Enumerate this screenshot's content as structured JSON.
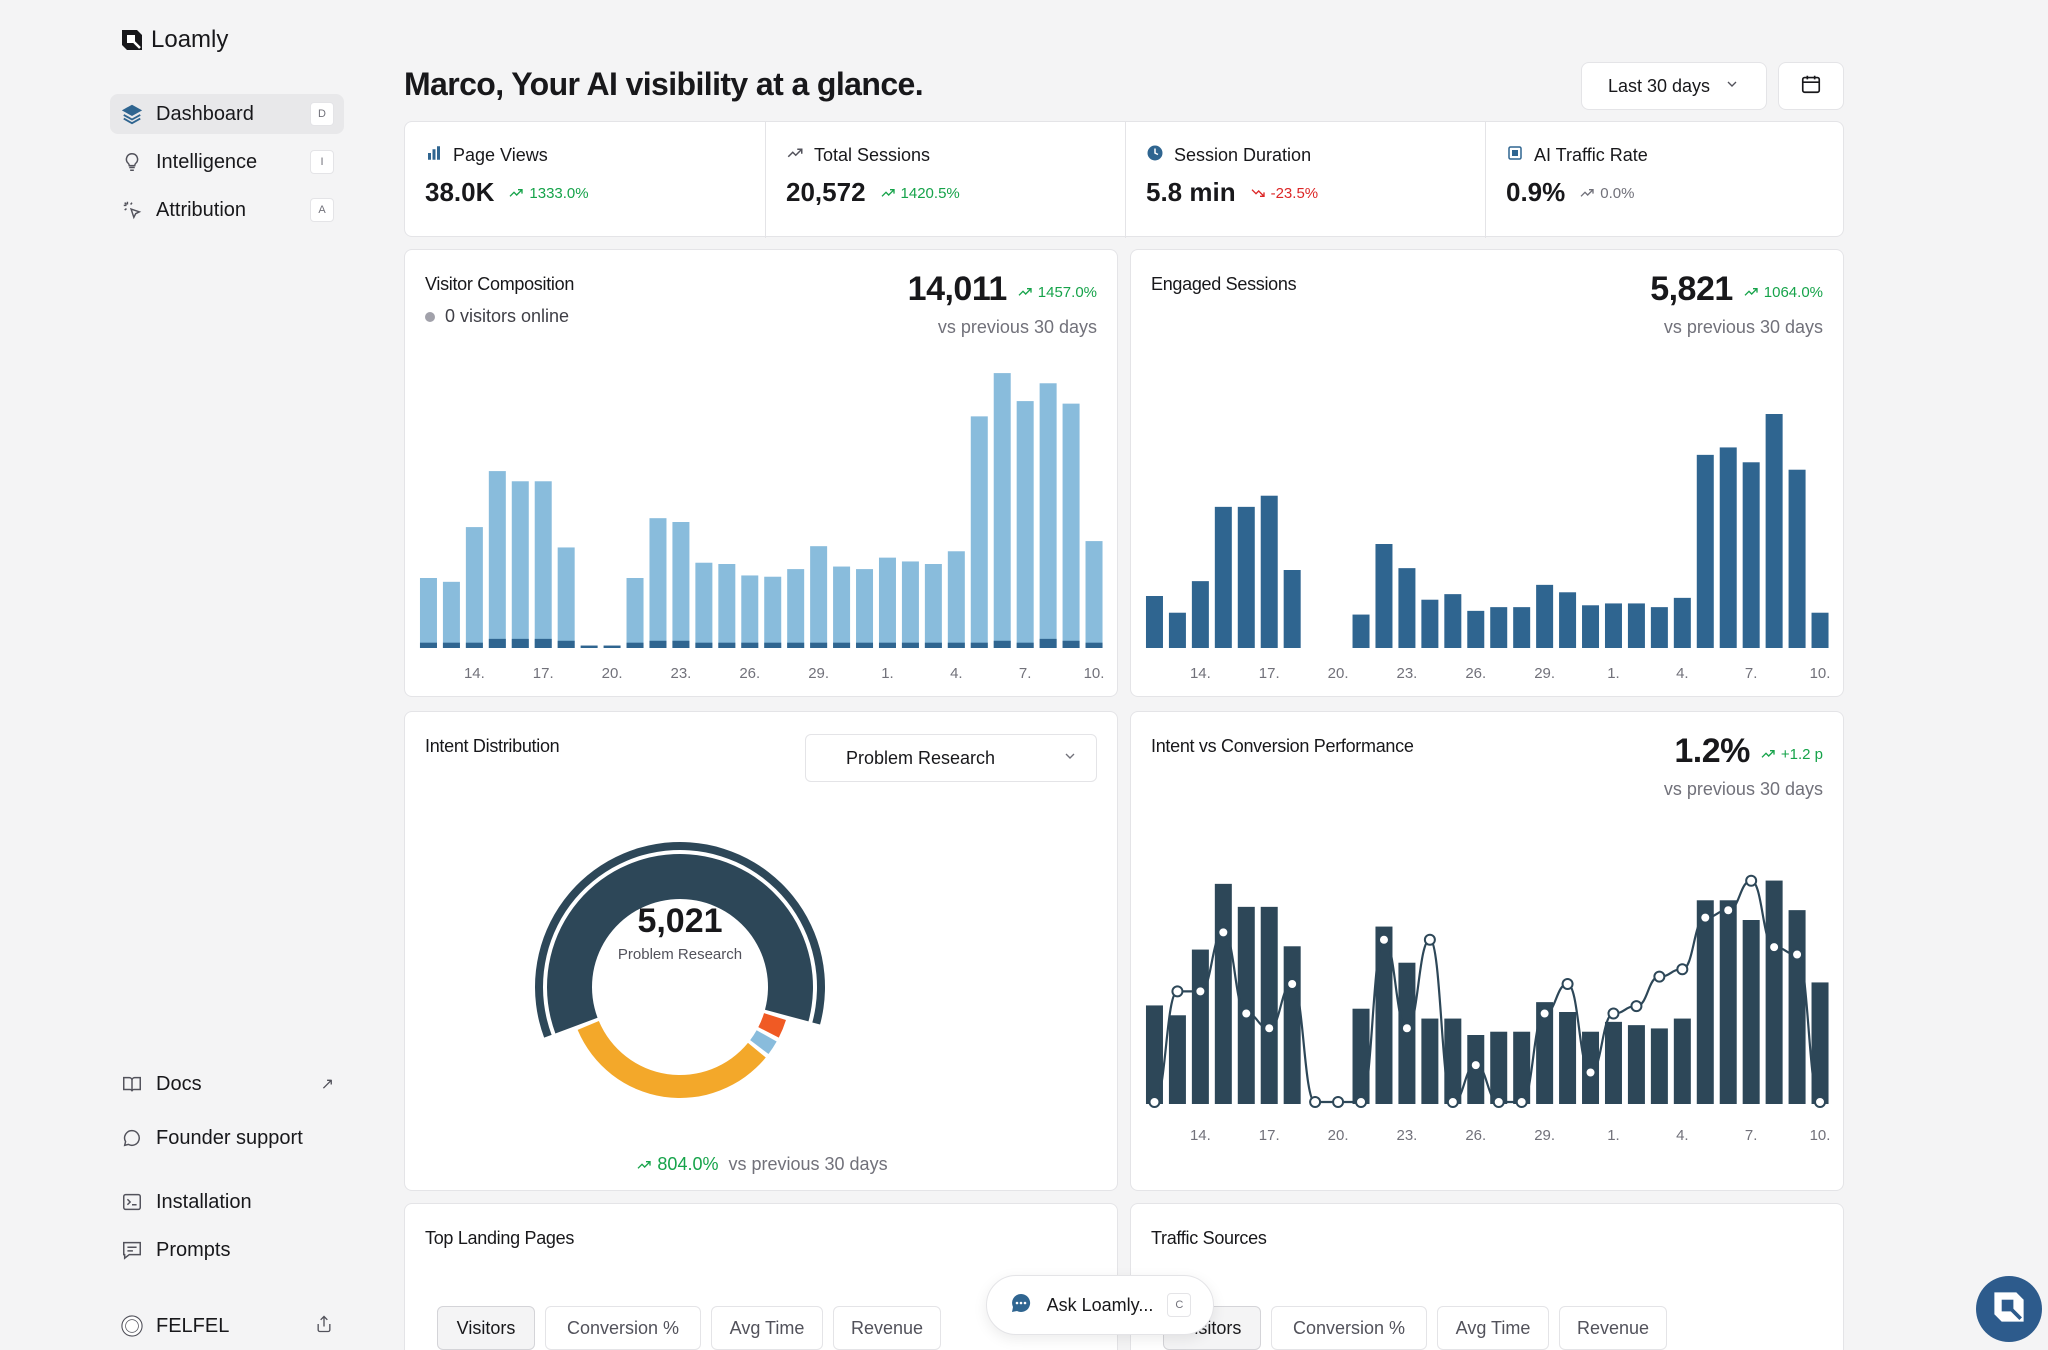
{
  "brand": {
    "name": "Loamly"
  },
  "sidebar": {
    "items": [
      {
        "label": "Dashboard",
        "key": "D"
      },
      {
        "label": "Intelligence",
        "key": "I"
      },
      {
        "label": "Attribution",
        "key": "A"
      }
    ],
    "bottom": [
      {
        "label": "Docs",
        "ext": "↗"
      },
      {
        "label": "Founder support"
      },
      {
        "label": "Installation"
      },
      {
        "label": "Prompts"
      }
    ],
    "workspace": "FELFEL"
  },
  "header": {
    "title": "Marco, Your AI visibility at a glance.",
    "range_label": "Last 30 days"
  },
  "stats": [
    {
      "label": "Page Views",
      "value": "38.0K",
      "change": "1333.0%",
      "dir": "up",
      "icon": "bar-chart-icon"
    },
    {
      "label": "Total Sessions",
      "value": "20,572",
      "change": "1420.5%",
      "dir": "up",
      "icon": "trend-icon"
    },
    {
      "label": "Session Duration",
      "value": "5.8 min",
      "change": "-23.5%",
      "dir": "down",
      "icon": "clock-icon"
    },
    {
      "label": "AI Traffic Rate",
      "value": "0.9%",
      "change": "0.0%",
      "dir": "flat",
      "icon": "chip-icon"
    }
  ],
  "visitor": {
    "title": "Visitor Composition",
    "online": "0 visitors online",
    "value": "14,011",
    "change": "1457.0%",
    "sub": "vs previous 30 days"
  },
  "engaged": {
    "title": "Engaged Sessions",
    "value": "5,821",
    "change": "1064.0%",
    "sub": "vs previous 30 days"
  },
  "intent": {
    "title": "Intent Distribution",
    "selected": "Problem Research",
    "center_value": "5,021",
    "center_label": "Problem Research",
    "change": "804.0%",
    "sub": "vs previous 30 days"
  },
  "ivc": {
    "title": "Intent vs Conversion Performance",
    "value": "1.2%",
    "change": "+1.2 p",
    "sub": "vs previous 30 days"
  },
  "landing": {
    "title": "Top Landing Pages",
    "tabs": [
      "Visitors",
      "Conversion %",
      "Avg Time",
      "Revenue"
    ]
  },
  "sources": {
    "title": "Traffic Sources",
    "tabs": [
      "Visitors",
      "Conversion %",
      "Avg Time",
      "Revenue"
    ]
  },
  "ask": {
    "label": "Ask Loamly...",
    "key": "C"
  },
  "colors": {
    "light_bar": "#89bcdc",
    "dark_bar": "#2f6590",
    "navy": "#2d4758",
    "orange": "#f3a82a",
    "red": "#f05a24",
    "sky": "#89bcdc",
    "up": "#16a34a",
    "down": "#dc2626"
  },
  "chart_data": [
    {
      "type": "bar",
      "name": "visitor-composition",
      "x": [
        "12",
        "13",
        "14",
        "15",
        "16",
        "17",
        "18",
        "19",
        "20",
        "21",
        "22",
        "23",
        "24",
        "25",
        "26",
        "27",
        "28",
        "29",
        "30",
        "31",
        "1",
        "2",
        "3",
        "4",
        "5",
        "6",
        "7",
        "8",
        "9",
        "10"
      ],
      "tick_labels": [
        "14.",
        "17.",
        "20.",
        "23.",
        "26.",
        "29.",
        "1.",
        "4.",
        "7.",
        "10."
      ],
      "series": [
        {
          "values": [
            550,
            520,
            950,
            1390,
            1310,
            1310,
            790,
            0,
            0,
            550,
            1020,
            990,
            670,
            660,
            570,
            560,
            620,
            800,
            640,
            620,
            710,
            680,
            660,
            760,
            1820,
            2160,
            1940,
            2080,
            1920,
            840
          ]
        },
        {
          "values": [
            20,
            20,
            20,
            40,
            40,
            40,
            30,
            5,
            5,
            20,
            30,
            30,
            20,
            20,
            20,
            20,
            20,
            20,
            20,
            20,
            20,
            20,
            20,
            20,
            20,
            30,
            20,
            40,
            30,
            20
          ]
        }
      ],
      "ylim": [
        0,
        2200
      ]
    },
    {
      "type": "bar",
      "name": "engaged-sessions",
      "x": [
        "12",
        "13",
        "14",
        "15",
        "16",
        "17",
        "18",
        "19",
        "20",
        "21",
        "22",
        "23",
        "24",
        "25",
        "26",
        "27",
        "28",
        "29",
        "30",
        "31",
        "1",
        "2",
        "3",
        "4",
        "5",
        "6",
        "7",
        "8",
        "9",
        "10"
      ],
      "tick_labels": [
        "14.",
        "17.",
        "20.",
        "23.",
        "26.",
        "29.",
        "1.",
        "4.",
        "7.",
        "10."
      ],
      "values": [
        140,
        95,
        180,
        380,
        380,
        410,
        210,
        0,
        0,
        90,
        280,
        215,
        130,
        145,
        100,
        110,
        110,
        170,
        150,
        115,
        120,
        120,
        110,
        135,
        520,
        540,
        500,
        630,
        480,
        95
      ],
      "ylim": [
        0,
        700
      ]
    },
    {
      "type": "pie",
      "name": "intent-distribution",
      "slices": [
        {
          "label": "Problem Research",
          "value": 5021
        },
        {
          "value": 2770
        },
        {
          "value": 230
        },
        {
          "value": 280
        }
      ]
    },
    {
      "type": "bar",
      "name": "intent-vs-conversion",
      "x": [
        "12",
        "13",
        "14",
        "15",
        "16",
        "17",
        "18",
        "19",
        "20",
        "21",
        "22",
        "23",
        "24",
        "25",
        "26",
        "27",
        "28",
        "29",
        "30",
        "31",
        "1",
        "2",
        "3",
        "4",
        "5",
        "6",
        "7",
        "8",
        "9",
        "10"
      ],
      "tick_labels": [
        "14.",
        "17.",
        "20.",
        "23.",
        "26.",
        "29.",
        "1.",
        "4.",
        "7.",
        "10."
      ],
      "series": [
        {
          "name": "",
          "values": [
            300,
            270,
            470,
            670,
            600,
            600,
            480,
            0,
            0,
            290,
            540,
            430,
            260,
            260,
            210,
            220,
            220,
            310,
            280,
            220,
            250,
            240,
            230,
            260,
            620,
            620,
            560,
            680,
            590,
            370
          ]
        },
        {
          "name": "",
          "values": [
            0,
            1.5,
            1.5,
            2.3,
            1.2,
            1.0,
            1.6,
            0,
            0,
            0,
            2.2,
            1.0,
            2.2,
            0,
            0.5,
            0,
            0,
            1.2,
            1.6,
            0.4,
            1.2,
            1.3,
            1.7,
            1.8,
            2.5,
            2.6,
            3.0,
            2.1,
            2.0,
            0
          ]
        }
      ],
      "ylim": [
        0,
        700
      ],
      "y2lim": [
        0,
        3.2
      ]
    }
  ]
}
